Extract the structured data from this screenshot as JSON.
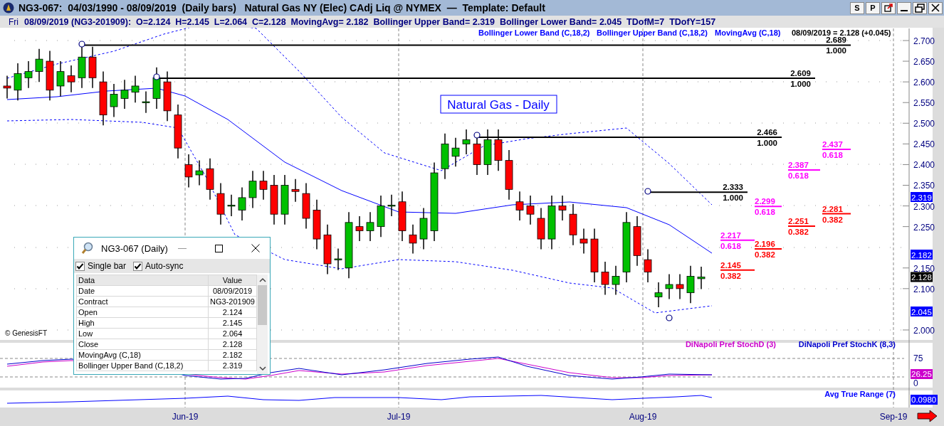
{
  "window": {
    "title": "NG3-067:  04/03/1990 - 08/09/2019  (Daily bars)   Natural Gas NY (Elec) CAdj Liq @ NYMEX  —  Template: Default",
    "buttons": [
      "S",
      "P"
    ]
  },
  "info_bar": {
    "day": "Fri",
    "text": "08/09/2019 (NG3-201909):  O=2.124  H=2.145  L=2.064  C=2.128  MovingAvg= 2.182  Bollinger Upper Band= 2.319  Bollinger Lower Band= 2.045  TDofM=7  TDofY=157"
  },
  "price_pane": {
    "legend": [
      "Bollinger Lower Band (C,18,2)",
      "Bollinger Upper Band (C,18,2)",
      "MovingAvg (C,18)"
    ],
    "last_value": "08/09/2019 = 2.128 (+0.045)",
    "title": "Natural Gas - Daily",
    "copyright": "© GenesisFT",
    "fib_levels": [
      {
        "price": "2.689",
        "ratio": "1.000",
        "kind": "swing",
        "color": "#000000"
      },
      {
        "price": "2.609",
        "ratio": "1.000",
        "kind": "swing",
        "color": "#000000"
      },
      {
        "price": "2.466",
        "ratio": "1.000",
        "kind": "swing",
        "color": "#000000"
      },
      {
        "price": "2.333",
        "ratio": "1.000",
        "kind": "swing",
        "color": "#000000"
      },
      {
        "price": "2.437",
        "ratio": "0.618",
        "kind": "retracement",
        "color": "#ff00ff"
      },
      {
        "price": "2.387",
        "ratio": "0.618",
        "kind": "retracement",
        "color": "#ff00ff"
      },
      {
        "price": "2.299",
        "ratio": "0.618",
        "kind": "retracement",
        "color": "#ff00ff"
      },
      {
        "price": "2.281",
        "ratio": "0.382",
        "kind": "retracement",
        "color": "#ff0000"
      },
      {
        "price": "2.251",
        "ratio": "0.382",
        "kind": "retracement",
        "color": "#ff0000"
      },
      {
        "price": "2.217",
        "ratio": "0.618",
        "kind": "retracement",
        "color": "#ff00ff"
      },
      {
        "price": "2.196",
        "ratio": "0.382",
        "kind": "retracement",
        "color": "#ff0000"
      },
      {
        "price": "2.145",
        "ratio": "0.382",
        "kind": "retracement",
        "color": "#ff0000"
      }
    ],
    "axis_ticks": [
      "2.700",
      "2.650",
      "2.600",
      "2.550",
      "2.500",
      "2.450",
      "2.400",
      "2.350",
      "2.300",
      "2.250",
      "2.150",
      "2.100",
      "2.000"
    ],
    "badges": [
      {
        "value": "2.319",
        "color": "#0000ff"
      },
      {
        "value": "2.182",
        "color": "#0000ff"
      },
      {
        "value": "2.128",
        "color": "#000000"
      },
      {
        "value": "2.045",
        "color": "#0000ff"
      }
    ]
  },
  "stoch_pane": {
    "legend": [
      {
        "label": "DiNapoli Pref StochD (3)",
        "color": "#cc00cc"
      },
      {
        "label": "DiNapoli Pref StochK (8,3)",
        "color": "#0000cc"
      }
    ],
    "axis_ticks": [
      "75",
      "0"
    ],
    "badge": {
      "value": "26.25",
      "color": "#cc00cc"
    }
  },
  "atr_pane": {
    "legend": "Avg True Range (7)",
    "badge": {
      "value": "0.0980",
      "color": "#0000ff"
    }
  },
  "date_axis": [
    "Jun-19",
    "Jul-19",
    "Aug-19",
    "Sep-19"
  ],
  "data_window": {
    "title": "NG3-067 (Daily)",
    "options": [
      {
        "label": "Single bar",
        "checked": true
      },
      {
        "label": "Auto-sync",
        "checked": true
      }
    ],
    "columns": [
      "Data",
      "Value"
    ],
    "rows": [
      [
        "Date",
        "08/09/2019"
      ],
      [
        "Contract",
        "NG3-201909"
      ],
      [
        "Open",
        "2.124"
      ],
      [
        "High",
        "2.145"
      ],
      [
        "Low",
        "2.064"
      ],
      [
        "Close",
        "2.128"
      ],
      [
        "MovingAvg (C,18)",
        "2.182"
      ],
      [
        "Bollinger Upper Band (C,18,2)",
        "2.319"
      ]
    ]
  }
}
